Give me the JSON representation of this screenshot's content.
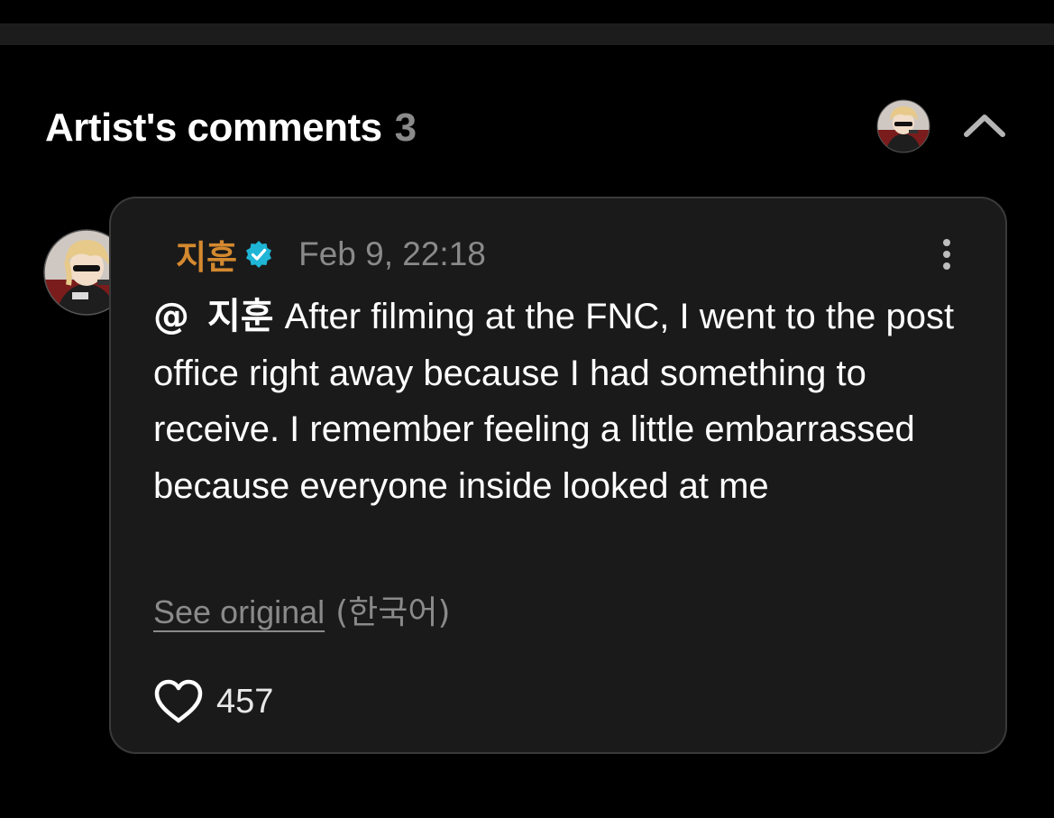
{
  "section": {
    "title": "Artist's comments",
    "count": "3"
  },
  "comment": {
    "author": "지훈",
    "timestamp": "Feb 9, 22:18",
    "mention_symbol": "@",
    "mention_name": "지훈",
    "text": "After filming at the FNC, I went to the post office right away because I had something to receive. I remember feeling a little embarrassed because everyone inside looked at me",
    "see_original_label": "See original",
    "original_language": "(한국어)",
    "like_count": "457"
  },
  "icons": {
    "verified": "verified-badge-icon",
    "collapse": "chevron-up-icon",
    "more": "more-vertical-icon",
    "like": "heart-icon"
  },
  "colors": {
    "background": "#000000",
    "card": "#1a1a1a",
    "author": "#d4892f",
    "verified": "#1fb5d6",
    "muted": "#8a8a8a"
  }
}
